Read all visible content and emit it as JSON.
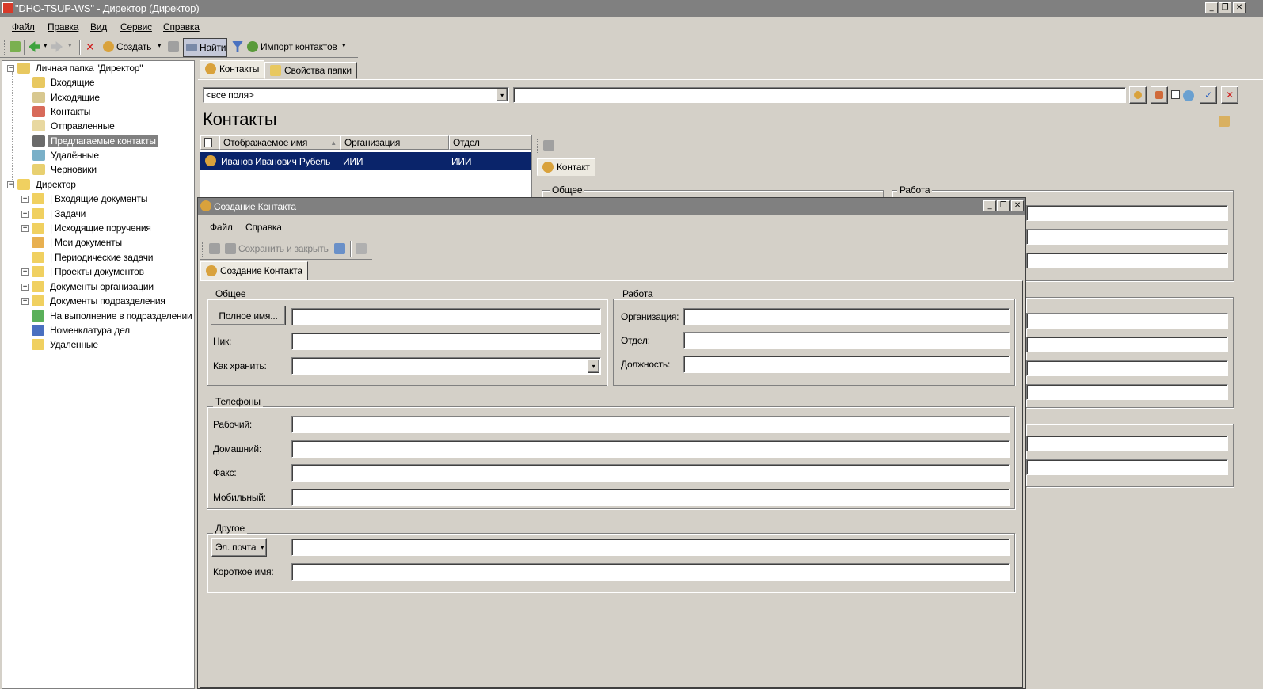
{
  "window": {
    "title": "\"DHO-TSUP-WS\" - Директор (Директор)",
    "min_glyph": "_",
    "restore_glyph": "❐",
    "close_glyph": "✕"
  },
  "menu": [
    "Файл",
    "Правка",
    "Вид",
    "Сервис",
    "Справка"
  ],
  "toolbar": {
    "delete_glyph": "✕",
    "create_label": "Создать",
    "find_label": "Найти",
    "import_label": "Импорт контактов",
    "dropdown_glyph": "▾"
  },
  "tree": {
    "personal_folder": "Личная папка \"Директор\"",
    "personal_items": [
      "Входящие",
      "Исходящие",
      "Контакты",
      "Отправленные",
      "Предлагаемые контакты",
      "Удалённые",
      "Черновики"
    ],
    "director": "Директор",
    "director_items": [
      "| Входящие документы",
      "| Задачи",
      "| Исходящие поручения",
      "| Мои документы",
      "| Периодические задачи",
      "| Проекты документов",
      "Документы организации",
      "Документы подразделения",
      "На выполнение в подразделении",
      "Номенклатура дел",
      "Удаленные"
    ],
    "expand_glyph": "+",
    "collapse_glyph": "−"
  },
  "main": {
    "tabs": [
      "Контакты",
      "Свойства папки"
    ],
    "field_selector": "<все поля>",
    "search_value": "",
    "heading": "Контакты",
    "columns": [
      "Отображаемое имя",
      "Организация",
      "Отдел"
    ],
    "sort_glyph": "▲",
    "rows": [
      {
        "name": "Иванов Иванович Рубель",
        "org": "ИИИ",
        "dept": "ИИИ"
      }
    ],
    "detail_tab": "Контакт",
    "detail_group_general": "Общее",
    "detail_group_work": "Работа"
  },
  "dialog": {
    "title": "Создание Контакта",
    "menu": [
      "Файл",
      "Справка"
    ],
    "save_close": "Сохранить и закрыть",
    "tab": "Создание Контакта",
    "general": {
      "title": "Общее",
      "fullname_button": "Полное имя...",
      "nick_label": "Ник:",
      "store_as_label": "Как хранить:"
    },
    "work": {
      "title": "Работа",
      "org_label": "Организация:",
      "dept_label": "Отдел:",
      "position_label": "Должность:"
    },
    "phones": {
      "title": "Телефоны",
      "work_label": "Рабочий:",
      "home_label": "Домашний:",
      "fax_label": "Факс:",
      "mobile_label": "Мобильный:"
    },
    "other": {
      "title": "Другое",
      "email_button": "Эл. почта",
      "short_name_label": "Короткое имя:"
    }
  }
}
